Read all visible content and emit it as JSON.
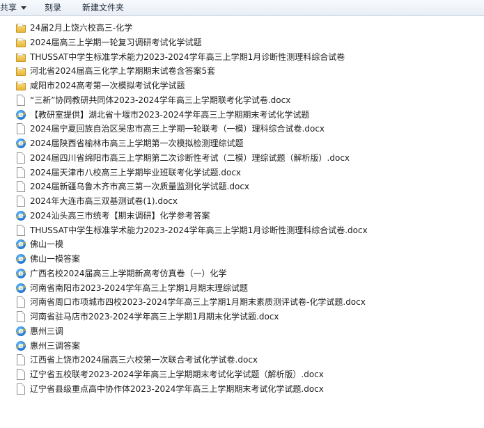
{
  "toolbar": {
    "share_label": "共享",
    "burn_label": "刻录",
    "new_folder_label": "新建文件夹"
  },
  "files": [
    {
      "icon": "folder-icon",
      "name": "24届2月上饶六校高三-化学"
    },
    {
      "icon": "folder-icon",
      "name": "2024届高三上学期一轮复习调研考试化学试题"
    },
    {
      "icon": "folder-icon",
      "name": "THUSSAT中学生标准学术能力2023-2024学年高三上学期1月诊断性测理科综合试卷"
    },
    {
      "icon": "folder-icon",
      "name": "河北省2024届高三化学上学期期末试卷含答案5套"
    },
    {
      "icon": "folder-icon",
      "name": "咸阳市2024高考第一次模拟考试化学试题"
    },
    {
      "icon": "doc-icon",
      "name": "“三新”协同教研共同体2023-2024学年高三上学期联考化学试卷.docx"
    },
    {
      "icon": "ie-icon",
      "name": "【教研室提供】湖北省十堰市2023-2024学年高三上学期期末考试化学试题"
    },
    {
      "icon": "doc-icon",
      "name": "2024届宁夏回族自治区吴忠市高三上学期一轮联考（一模）理科综合试卷.docx"
    },
    {
      "icon": "ie-icon",
      "name": "2024届陕西省榆林市高三上学期第一次模拟检测理综试题"
    },
    {
      "icon": "doc-icon",
      "name": "2024届四川省绵阳市高三上学期第二次诊断性考试（二模）理综试题（解析版）.docx"
    },
    {
      "icon": "doc-icon",
      "name": "2024届天津市八校高三上学期毕业班联考化学试题.docx"
    },
    {
      "icon": "doc-icon",
      "name": "2024届新疆乌鲁木齐市高三第一次质量监测化学试题.docx"
    },
    {
      "icon": "doc-icon",
      "name": "2024年大连市高三双基测试卷(1).docx"
    },
    {
      "icon": "ie-icon",
      "name": "2024汕头高三市统考【期末调研】化学参考答案"
    },
    {
      "icon": "doc-icon",
      "name": "THUSSAT中学生标准学术能力2023-2024学年高三上学期1月诊断性测理科综合试卷.docx"
    },
    {
      "icon": "ie-icon",
      "name": "佛山一模"
    },
    {
      "icon": "ie-icon",
      "name": "佛山一模答案"
    },
    {
      "icon": "ie-icon",
      "name": "广西名校2024届高三上学期新高考仿真卷（一）化学"
    },
    {
      "icon": "ie-icon",
      "name": "河南省南阳市2023-2024学年高三上学期1月期末理综试题"
    },
    {
      "icon": "doc-icon",
      "name": "河南省周口市项城市四校2023-2024学年高三上学期1月期末素质测评试卷-化学试题.docx"
    },
    {
      "icon": "doc-icon",
      "name": "河南省驻马店市2023-2024学年高三上学期1月期末化学试题.docx"
    },
    {
      "icon": "ie-icon",
      "name": "惠州三调"
    },
    {
      "icon": "ie-icon",
      "name": "惠州三调答案"
    },
    {
      "icon": "doc-icon",
      "name": "江西省上饶市2024届高三六校第一次联合考试化学试卷.docx"
    },
    {
      "icon": "doc-icon",
      "name": "辽宁省五校联考2023-2024学年高三上学期期末考试化学试题（解析版）.docx"
    },
    {
      "icon": "doc-icon",
      "name": "辽宁省县级重点高中协作体2023-2024学年高三上学期期末考试化学试题.docx"
    }
  ]
}
